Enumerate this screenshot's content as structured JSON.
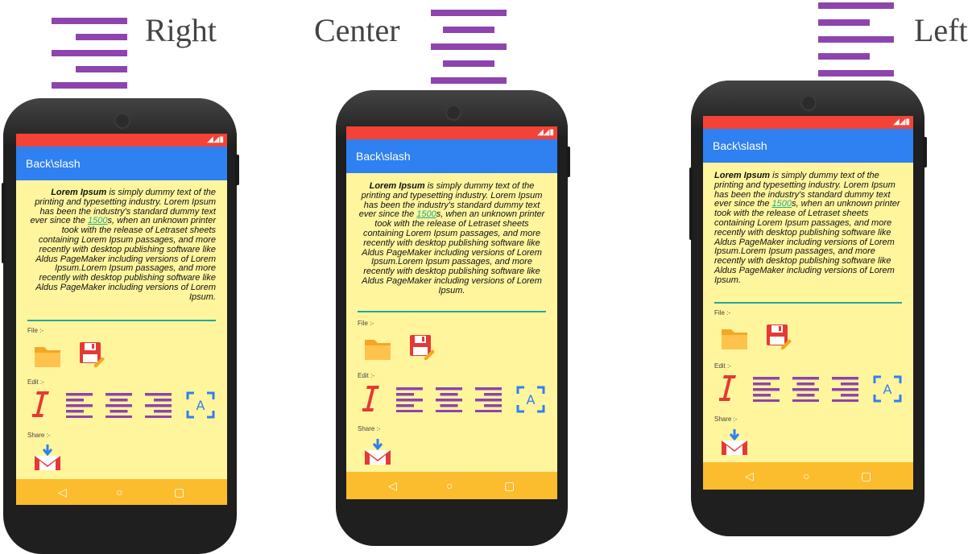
{
  "headings": {
    "right": "Right",
    "center": "Center",
    "left": "Left"
  },
  "app": {
    "title": "Back\\slash"
  },
  "text": {
    "bold": "Lorem Ipsum",
    "part1": " is simply dummy text of the printing and typesetting industry. Lorem Ipsum has been the industry's standard dummy text ever since the ",
    "link": "1500",
    "part2": "s, when an unknown printer took with the release of Letraset sheets containing Lorem Ipsum passages, and more recently with desktop publishing software like Aldus PageMaker including versions of Lorem Ipsum.Lorem Ipsum passages, and more recently with desktop publishing software like Aldus PageMaker including versions of Lorem Ipsum."
  },
  "labels": {
    "file": "File :-",
    "edit": "Edit :-",
    "share": "Share :-"
  },
  "icons": [
    "folder-icon",
    "save-icon",
    "italic-icon",
    "align-left-icon",
    "align-center-icon",
    "align-right-icon",
    "text-select-icon",
    "gmail-icon",
    "back-icon",
    "home-icon",
    "recents-icon"
  ],
  "nav": {
    "back": "◁",
    "home": "○",
    "recents": "▢"
  },
  "colors": {
    "accent": "#8e44ad",
    "status": "#f44336",
    "appbar": "#2f80f0",
    "screen": "#fff59d",
    "navbar": "#fbbd2e"
  }
}
